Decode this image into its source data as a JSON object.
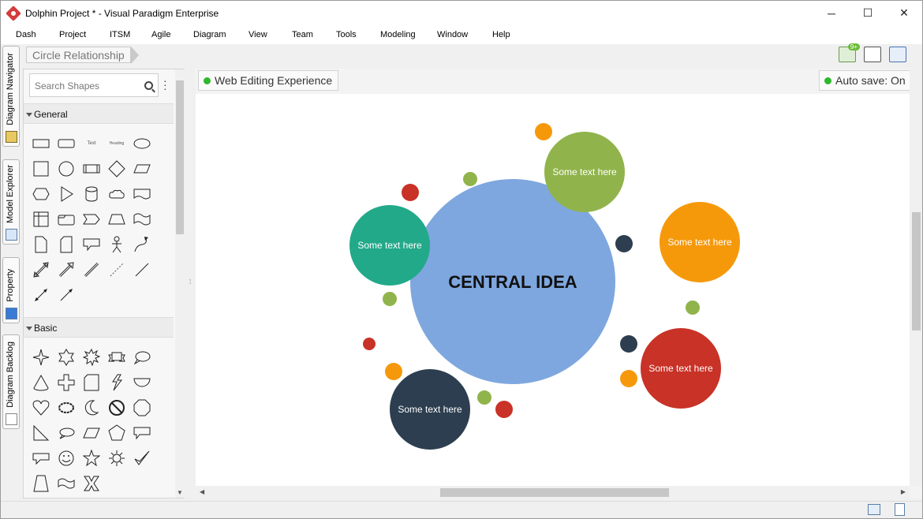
{
  "window": {
    "title": "Dolphin Project * - Visual Paradigm Enterprise",
    "minimize": "─",
    "maximize": "☐",
    "close": "✕"
  },
  "menu": [
    "Dash",
    "Project",
    "ITSM",
    "Agile",
    "Diagram",
    "View",
    "Team",
    "Tools",
    "Modeling",
    "Window",
    "Help"
  ],
  "side_tabs": [
    "Diagram Navigator",
    "Model Explorer",
    "Property",
    "Diagram Backlog"
  ],
  "breadcrumb": "Circle Relationship",
  "toolbar": {
    "notification_badge": "9+"
  },
  "shape_panel": {
    "search_placeholder": "Search Shapes",
    "sections": [
      {
        "label": "General"
      },
      {
        "label": "Basic"
      }
    ],
    "general_text_shape": "Text",
    "general_heading_shape": "Heading"
  },
  "editor": {
    "web_editing": "Web Editing Experience",
    "autosave": "Auto save: On"
  },
  "diagram": {
    "central": {
      "label": "CENTRAL IDEA",
      "color": "#7ea7df"
    },
    "nodes": [
      {
        "label": "Some text here",
        "color": "#90b44b"
      },
      {
        "label": "Some text here",
        "color": "#f5990b"
      },
      {
        "label": "Some text here",
        "color": "#22a98a"
      },
      {
        "label": "Some text here",
        "color": "#c93227"
      },
      {
        "label": "Some text here",
        "color": "#2d3e50"
      }
    ],
    "colors": {
      "green": "#90b44b",
      "orange": "#f5990b",
      "red": "#c93227",
      "navy": "#2d3e50",
      "teal": "#22a98a"
    }
  },
  "status_icons": [
    "mail-icon",
    "document-icon"
  ]
}
